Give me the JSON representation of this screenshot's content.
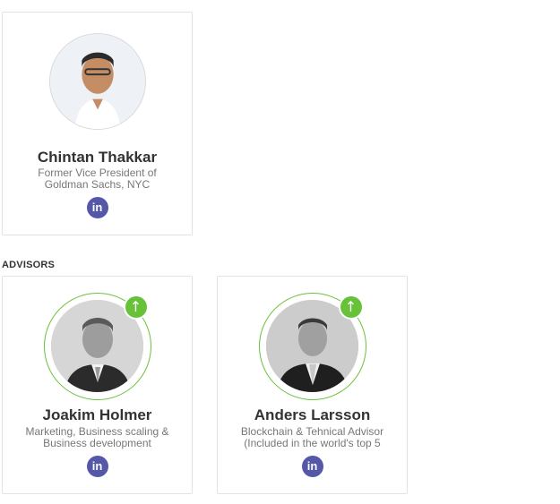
{
  "team": {
    "member": {
      "name": "Chintan Thakkar",
      "description": "Former Vice President of Goldman Sachs, NYC",
      "linkedin_label": "in"
    }
  },
  "advisors": {
    "title": "ADVISORS",
    "items": [
      {
        "name": "Joakim Holmer",
        "description": "Marketing, Business scaling & Business development",
        "linkedin_label": "in",
        "badge_icon": "arrow-up-icon"
      },
      {
        "name": "Anders Larsson",
        "description": "Blockchain & Tehnical Advisor (Included in the world's top 5",
        "linkedin_label": "in",
        "badge_icon": "arrow-up-icon"
      }
    ]
  },
  "colors": {
    "accent_green": "#67c23a",
    "linkedin_purple": "#5557a8",
    "border": "#e3e3e3"
  }
}
